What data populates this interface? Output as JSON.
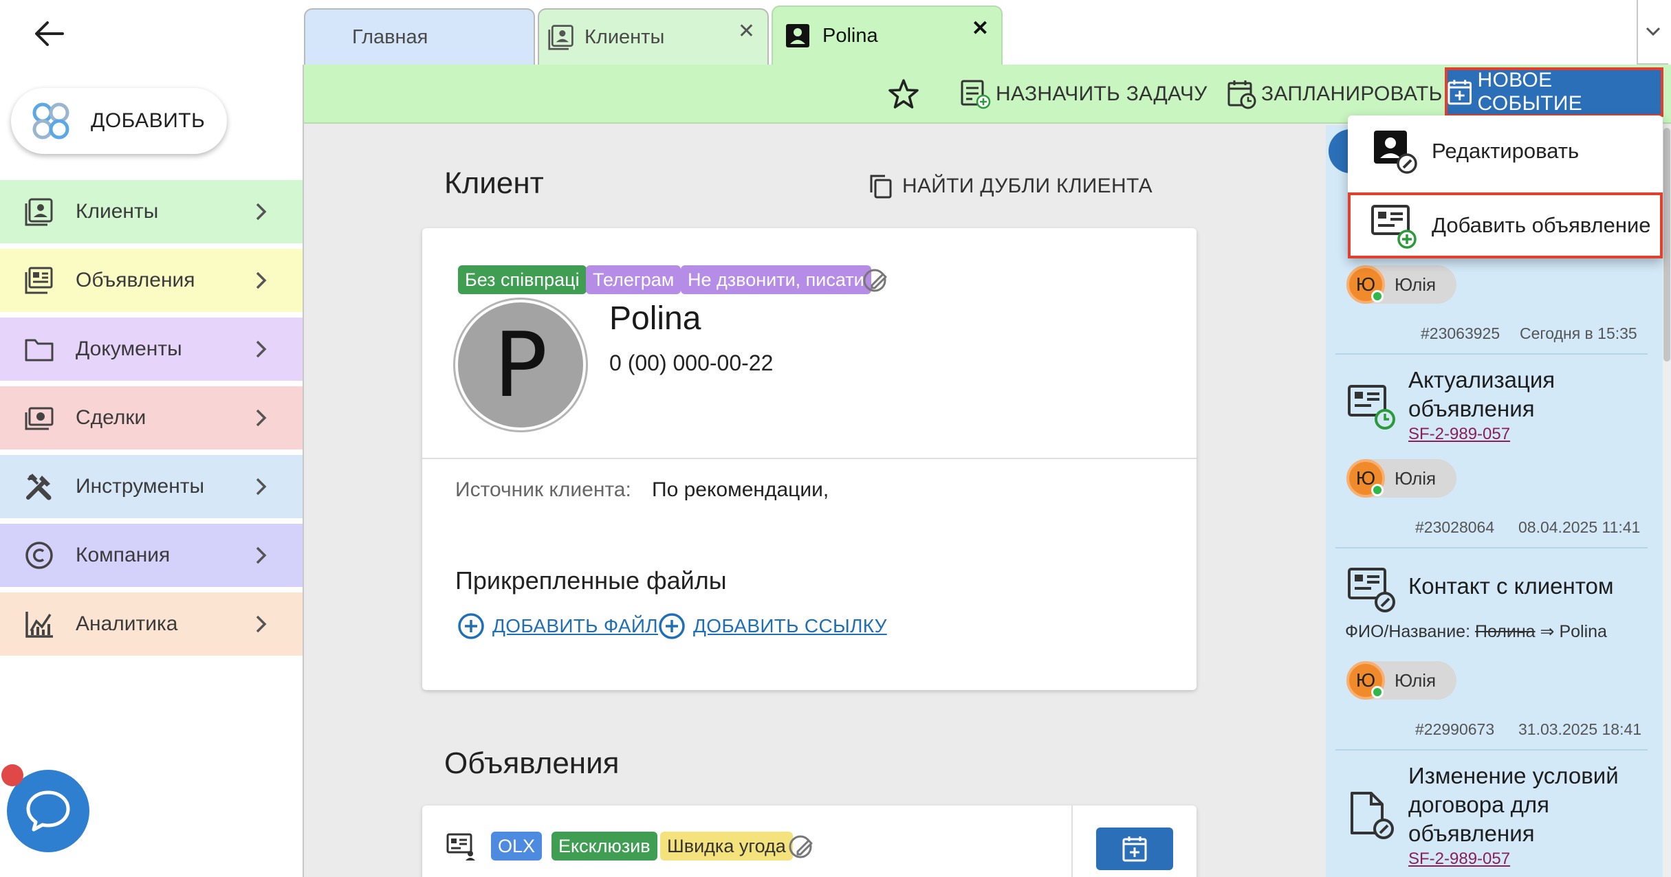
{
  "sidebar": {
    "add_label": "ДОБАВИТЬ",
    "items": [
      {
        "label": "Клиенты",
        "icon": "contacts-icon",
        "color": "#d3f7d0"
      },
      {
        "label": "Объявления",
        "icon": "listings-icon",
        "color": "#fafcc4"
      },
      {
        "label": "Документы",
        "icon": "folder-icon",
        "color": "#e6d4fa"
      },
      {
        "label": "Сделки",
        "icon": "money-icon",
        "color": "#f8d4d4"
      },
      {
        "label": "Инструменты",
        "icon": "tools-icon",
        "color": "#d6e8f8"
      },
      {
        "label": "Компания",
        "icon": "copyright-icon",
        "color": "#d4d2fa"
      },
      {
        "label": "Аналитика",
        "icon": "analytics-icon",
        "color": "#fbe5d2"
      }
    ]
  },
  "tabs": [
    {
      "label": "Главная"
    },
    {
      "label": "Клиенты"
    },
    {
      "label": "Polina"
    }
  ],
  "toolbar": {
    "assign_task": "НАЗНАЧИТЬ ЗАДАЧУ",
    "schedule": "ЗАПЛАНИРОВАТЬ",
    "new_event": "НОВОЕ СОБЫТИЕ"
  },
  "menu": {
    "edit": "Редактировать",
    "add_listing": "Добавить объявление"
  },
  "client": {
    "section_title": "Клиент",
    "find_dupes": "НАЙТИ ДУБЛИ КЛИЕНТА",
    "tags": [
      "Без співпраці",
      "Телеграм",
      "Не дзвонити, писати"
    ],
    "avatar_letter": "P",
    "name": "Polina",
    "phone": "0 (00) 000-00-22",
    "source_label": "Источник клиента:",
    "source_value": "По рекомендации,",
    "files_title": "Прикрепленные файлы",
    "add_file": "ДОБАВИТЬ ФАЙЛ",
    "add_link": "ДОБАВИТЬ ССЫЛКУ"
  },
  "listings": {
    "section_title": "Объявления",
    "tags": [
      "OLX",
      "Ексклюзив",
      "Швидка угода"
    ]
  },
  "feed": {
    "items": [
      {
        "user_initial": "Ю",
        "user_name": "Юлія",
        "id": "#23063925",
        "time": "Сегодня в 15:35"
      },
      {
        "title_lines": [
          "Актуализация",
          "объявления"
        ],
        "link": "SF-2-989-057",
        "user_initial": "Ю",
        "user_name": "Юлія",
        "id": "#23028064",
        "time": "08.04.2025 11:41"
      },
      {
        "title_lines": [
          "Контакт с клиентом"
        ],
        "change_prefix": "ФИО/Название:",
        "change_old": "Полина",
        "change_arrow": "⇒",
        "change_new": "Polina",
        "user_initial": "Ю",
        "user_name": "Юлія",
        "id": "#22990673",
        "time": "31.03.2025 18:41"
      },
      {
        "title_lines": [
          "Изменение условий",
          "договора для",
          "объявления"
        ],
        "link": "SF-2-989-057"
      }
    ]
  },
  "colors": {
    "accent_blue": "#2b6fb8",
    "toolbar_green": "#c8f5c0",
    "highlight_red": "#e1402e",
    "feed_bg": "#d3e9f8"
  }
}
